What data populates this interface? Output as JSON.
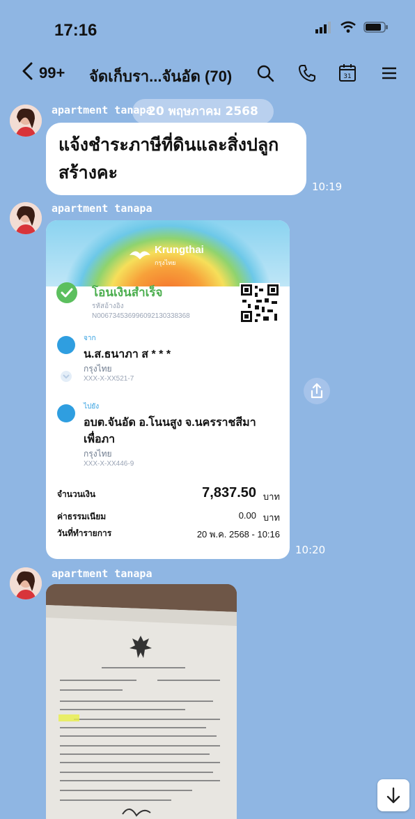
{
  "status": {
    "time": "17:16"
  },
  "header": {
    "back_count": "99+",
    "title": "จัดเก็บรา...จันอัด (70)"
  },
  "chat": {
    "date_separator": "20 พฤษภาคม 2568",
    "messages": [
      {
        "sender": "apartment tanapa",
        "text_line1": "แจ้งชำระภาษีที่ดินและสิ่งปลูก",
        "text_line2": "สร้างคะ",
        "time": "10:19"
      },
      {
        "sender": "apartment tanapa",
        "time": "10:20",
        "receipt": {
          "bank_logo_text": "Krungthai",
          "bank_logo_sub": "กรุงไทย",
          "status": "โอนเงินสำเร็จ",
          "ref_label": "รหัสอ้างอิง",
          "ref_number": "N006734536996092130338368",
          "from_label": "จาก",
          "from_name": "น.ส.ธนาภา ส * * *",
          "from_bank": "กรุงไทย",
          "from_account": "XXX-X-XX521-7",
          "to_label": "ไปยัง",
          "to_name_line1": "อบต.จันอัด อ.โนนสูง จ.นครราชสีมา",
          "to_name_line2": "เพื่อภา",
          "to_bank": "กรุงไทย",
          "to_account": "XXX-X-XX446-9",
          "amount_label": "จำนวนเงิน",
          "amount_value": "7,837.50",
          "amount_unit": "บาท",
          "fee_label": "ค่าธรรมเนียม",
          "fee_value": "0.00",
          "fee_unit": "บาท",
          "date_label": "วันที่ทำรายการ",
          "date_value": "20 พ.ค. 2568 - 10:16"
        }
      },
      {
        "sender": "apartment tanapa",
        "type": "image"
      }
    ]
  }
}
